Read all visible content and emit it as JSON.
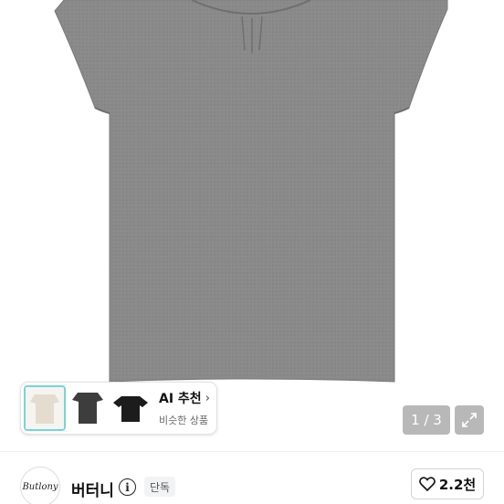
{
  "product_image": {
    "alt_icon": "gray-cap-sleeve-tshirt"
  },
  "ai_recommend": {
    "title": "AI 추천",
    "subtitle": "비슷한 상품",
    "thumbnail_colors": [
      "#e8e2d6",
      "#3a3a3a",
      "#1c1c1c"
    ]
  },
  "gallery": {
    "counter": "1 / 3"
  },
  "seller": {
    "avatar_text": "Butlony",
    "name": "버터니",
    "badge": "단독"
  },
  "like": {
    "count": "2.2천"
  },
  "colors": {
    "shirt": "#888888",
    "overlay": "rgba(0,0,0,0.28)",
    "highlight_border": "#79d4d7"
  }
}
